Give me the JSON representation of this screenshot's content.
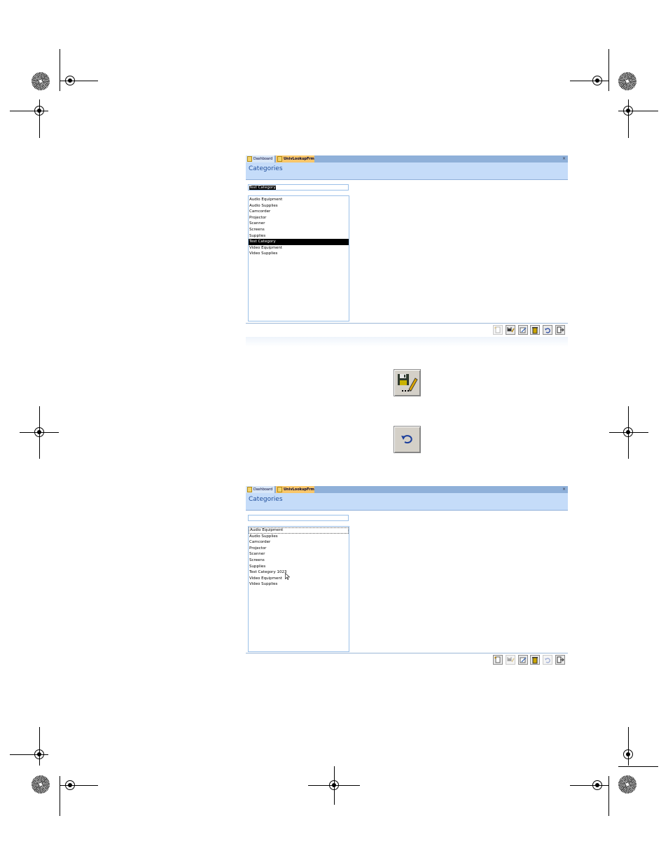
{
  "top_window": {
    "tabs": [
      {
        "label": "Dashboard"
      },
      {
        "label": "UnivLookupFrm"
      }
    ],
    "close_glyph": "×",
    "header_title": "Categories",
    "text_field_value": "Test Category",
    "list_items": [
      "Audio Equipment",
      "Audio Supplies",
      "Camcorder",
      "Projector",
      "Scanner",
      "Screens",
      "Supplies",
      "Test Category",
      "Video Equipment",
      "Video Supplies"
    ],
    "selected_item": "Test Category",
    "toolbar_buttons": [
      {
        "icon": "new-record-icon",
        "enabled": false
      },
      {
        "icon": "save-record-icon",
        "enabled": true
      },
      {
        "icon": "edit-record-icon",
        "enabled": true
      },
      {
        "icon": "delete-icon",
        "enabled": true
      },
      {
        "icon": "undo-icon",
        "enabled": true
      },
      {
        "icon": "exit-icon",
        "enabled": true
      }
    ]
  },
  "enlarged_buttons": [
    {
      "icon": "save-edit-icon"
    },
    {
      "icon": "undo-icon"
    }
  ],
  "bottom_window": {
    "tabs": [
      {
        "label": "Dashboard"
      },
      {
        "label": "UnivLookupFrm"
      }
    ],
    "close_glyph": "×",
    "header_title": "Categories",
    "text_field_value": "",
    "list_items": [
      "Audio Equipment",
      "Audio Supplies",
      "Camcorder",
      "Projector",
      "Scanner",
      "Screens",
      "Supplies",
      "Test Category 1023",
      "Video Equipment",
      "Video Supplies"
    ],
    "focused_item": "Audio Equipment",
    "toolbar_buttons": [
      {
        "icon": "new-record-icon",
        "enabled": true
      },
      {
        "icon": "save-record-icon",
        "enabled": false
      },
      {
        "icon": "edit-record-icon",
        "enabled": true
      },
      {
        "icon": "delete-icon",
        "enabled": true
      },
      {
        "icon": "undo-icon",
        "enabled": false
      },
      {
        "icon": "exit-icon",
        "enabled": true
      }
    ]
  },
  "colors": {
    "tab_strip": "#8fb0d9",
    "header_bg": "#c5dcf9",
    "header_text": "#1f4e9c",
    "active_tab": "#f8c66a",
    "selection": "#000000"
  }
}
